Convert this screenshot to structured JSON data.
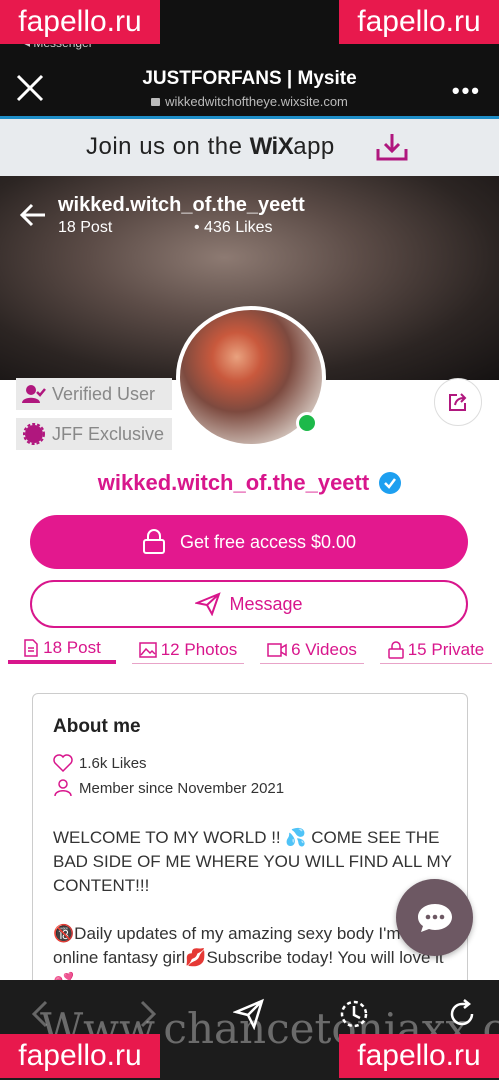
{
  "status": {
    "back_label": "◂ Messenger"
  },
  "browser": {
    "title": "JUSTFORFANS | Mysite",
    "url": "wikkedwitchoftheye.wixsite.com"
  },
  "wix_banner": {
    "text_pre": "Join us on the ",
    "brand": "WiX",
    "text_post": "app"
  },
  "cover": {
    "name": "wikked.witch_of.the_yeett",
    "posts": "18 Post",
    "likes": "• 436 Likes"
  },
  "badges": {
    "verified": "Verified User",
    "exclusive": "JFF Exclusive"
  },
  "profile": {
    "name": "wikked.witch_of.the_yeett"
  },
  "actions": {
    "access": "Get free access $0.00",
    "message": "Message"
  },
  "tabs": [
    {
      "label": "18 Post"
    },
    {
      "label": "12 Photos"
    },
    {
      "label": "6 Videos"
    },
    {
      "label": "15 Private"
    }
  ],
  "about": {
    "title": "About me",
    "likes": "1.6k Likes",
    "member_since": "Member since November 2021",
    "bio": "WELCOME TO MY WORLD !! 💦 COME SEE THE BAD SIDE OF ME WHERE YOU WILL FIND ALL MY CONTENT!!!\n\n🔞Daily updates of my amazing sexy body I'm your online fantasy girl💋Subscribe today! You will love it💕"
  },
  "watermarks": {
    "corner": "fapello.ru",
    "bottom": "Www.chancetonjaxx.com"
  },
  "colors": {
    "accent": "#e3188e",
    "online": "#1db94a",
    "verified": "#1d9ff0",
    "wix_line": "#1e8ec8"
  }
}
